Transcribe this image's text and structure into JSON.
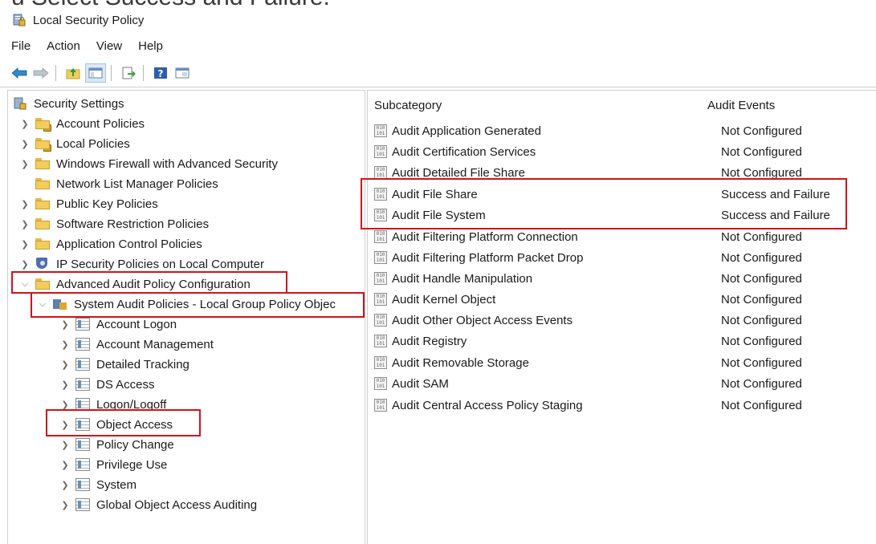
{
  "window": {
    "title": "Local Security Policy",
    "cropped_heading": "u Select Success and Failure."
  },
  "menu": [
    "File",
    "Action",
    "View",
    "Help"
  ],
  "toolbar": {
    "buttons": [
      "back-arrow-icon",
      "forward-arrow-icon",
      "up-folder-icon",
      "show-hide-tree-icon",
      "export-list-icon",
      "help-icon",
      "console-icon"
    ]
  },
  "tree": {
    "root": "Security Settings",
    "nodes": [
      {
        "label": "Account Policies",
        "icon": "folder-lock-icon"
      },
      {
        "label": "Local Policies",
        "icon": "folder-lock-icon"
      },
      {
        "label": "Windows Firewall with Advanced Security",
        "icon": "folder-icon"
      },
      {
        "label": "Network List Manager Policies",
        "icon": "folder-icon"
      },
      {
        "label": "Public Key Policies",
        "icon": "folder-icon"
      },
      {
        "label": "Software Restriction Policies",
        "icon": "folder-icon"
      },
      {
        "label": "Application Control Policies",
        "icon": "folder-icon"
      },
      {
        "label": "IP Security Policies on Local Computer",
        "icon": "shield-icon"
      },
      {
        "label": "Advanced Audit Policy Configuration",
        "icon": "folder-icon"
      },
      {
        "label": "System Audit Policies - Local Group Policy Objec",
        "icon": "system-audit-icon"
      },
      {
        "label": "Account Logon",
        "icon": "policy-icon"
      },
      {
        "label": "Account Management",
        "icon": "policy-icon"
      },
      {
        "label": "Detailed Tracking",
        "icon": "policy-icon"
      },
      {
        "label": "DS Access",
        "icon": "policy-icon"
      },
      {
        "label": "Logon/Logoff",
        "icon": "policy-icon"
      },
      {
        "label": "Object Access",
        "icon": "policy-icon"
      },
      {
        "label": "Policy Change",
        "icon": "policy-icon"
      },
      {
        "label": "Privilege Use",
        "icon": "policy-icon"
      },
      {
        "label": "System",
        "icon": "policy-icon"
      },
      {
        "label": "Global Object Access Auditing",
        "icon": "policy-icon"
      }
    ]
  },
  "list": {
    "headers": {
      "subcategory": "Subcategory",
      "audit_events": "Audit Events"
    },
    "rows": [
      {
        "subcategory": "Audit Application Generated",
        "audit": "Not Configured"
      },
      {
        "subcategory": "Audit Certification Services",
        "audit": "Not Configured"
      },
      {
        "subcategory": "Audit Detailed File Share",
        "audit": "Not Configured"
      },
      {
        "subcategory": "Audit File Share",
        "audit": "Success and Failure"
      },
      {
        "subcategory": "Audit File System",
        "audit": "Success and Failure"
      },
      {
        "subcategory": "Audit Filtering Platform Connection",
        "audit": "Not Configured"
      },
      {
        "subcategory": "Audit Filtering Platform Packet Drop",
        "audit": "Not Configured"
      },
      {
        "subcategory": "Audit Handle Manipulation",
        "audit": "Not Configured"
      },
      {
        "subcategory": "Audit Kernel Object",
        "audit": "Not Configured"
      },
      {
        "subcategory": "Audit Other Object Access Events",
        "audit": "Not Configured"
      },
      {
        "subcategory": "Audit Registry",
        "audit": "Not Configured"
      },
      {
        "subcategory": "Audit Removable Storage",
        "audit": "Not Configured"
      },
      {
        "subcategory": "Audit SAM",
        "audit": "Not Configured"
      },
      {
        "subcategory": "Audit Central Access Policy Staging",
        "audit": "Not Configured"
      }
    ]
  },
  "colors": {
    "highlight": "#d2121a",
    "folder": "#f2cd5c"
  }
}
